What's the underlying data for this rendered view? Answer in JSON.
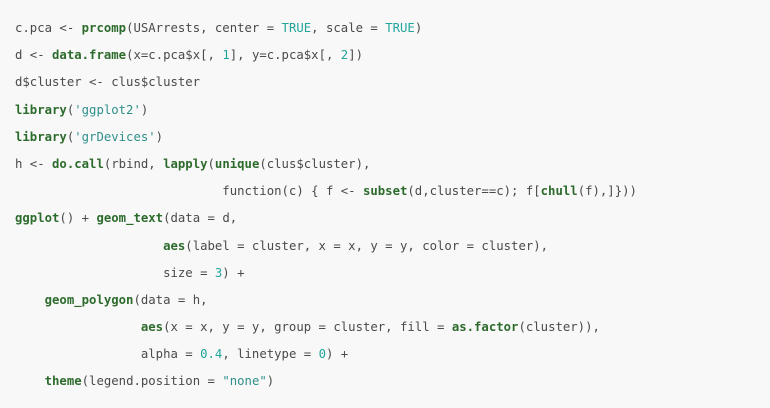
{
  "code": {
    "language": "R",
    "lines": [
      [
        {
          "t": "c.pca <- ",
          "c": "plain"
        },
        {
          "t": "prcomp",
          "c": "fn"
        },
        {
          "t": "(USArrests, center = ",
          "c": "plain"
        },
        {
          "t": "TRUE",
          "c": "kw"
        },
        {
          "t": ", scale = ",
          "c": "plain"
        },
        {
          "t": "TRUE",
          "c": "kw"
        },
        {
          "t": ")",
          "c": "plain"
        }
      ],
      [
        {
          "t": "d <- ",
          "c": "plain"
        },
        {
          "t": "data.frame",
          "c": "fn"
        },
        {
          "t": "(x=c.pca$x[, ",
          "c": "plain"
        },
        {
          "t": "1",
          "c": "num"
        },
        {
          "t": "], y=c.pca$x[, ",
          "c": "plain"
        },
        {
          "t": "2",
          "c": "num"
        },
        {
          "t": "])",
          "c": "plain"
        }
      ],
      [
        {
          "t": "d$cluster <- clus$cluster",
          "c": "plain"
        }
      ],
      [
        {
          "t": "library",
          "c": "fn"
        },
        {
          "t": "(",
          "c": "plain"
        },
        {
          "t": "'ggplot2'",
          "c": "str"
        },
        {
          "t": ")",
          "c": "plain"
        }
      ],
      [
        {
          "t": "library",
          "c": "fn"
        },
        {
          "t": "(",
          "c": "plain"
        },
        {
          "t": "'grDevices'",
          "c": "str"
        },
        {
          "t": ")",
          "c": "plain"
        }
      ],
      [
        {
          "t": "h <- ",
          "c": "plain"
        },
        {
          "t": "do.call",
          "c": "fn"
        },
        {
          "t": "(rbind, ",
          "c": "plain"
        },
        {
          "t": "lapply",
          "c": "fn"
        },
        {
          "t": "(",
          "c": "plain"
        },
        {
          "t": "unique",
          "c": "fn"
        },
        {
          "t": "(clus$cluster),",
          "c": "plain"
        }
      ],
      [
        {
          "t": "                            function(c) { f <- ",
          "c": "plain"
        },
        {
          "t": "subset",
          "c": "fn"
        },
        {
          "t": "(d,cluster==c); f[",
          "c": "plain"
        },
        {
          "t": "chull",
          "c": "fn"
        },
        {
          "t": "(f),]}))",
          "c": "plain"
        }
      ],
      [
        {
          "t": "ggplot",
          "c": "fn"
        },
        {
          "t": "() + ",
          "c": "plain"
        },
        {
          "t": "geom_text",
          "c": "fn"
        },
        {
          "t": "(data = d,",
          "c": "plain"
        }
      ],
      [
        {
          "t": "                    ",
          "c": "plain"
        },
        {
          "t": "aes",
          "c": "fn"
        },
        {
          "t": "(label = cluster, x = x, y = y, color = cluster),",
          "c": "plain"
        }
      ],
      [
        {
          "t": "                    size = ",
          "c": "plain"
        },
        {
          "t": "3",
          "c": "num"
        },
        {
          "t": ") +",
          "c": "plain"
        }
      ],
      [
        {
          "t": "    ",
          "c": "plain"
        },
        {
          "t": "geom_polygon",
          "c": "fn"
        },
        {
          "t": "(data = h,",
          "c": "plain"
        }
      ],
      [
        {
          "t": "                 ",
          "c": "plain"
        },
        {
          "t": "aes",
          "c": "fn"
        },
        {
          "t": "(x = x, y = y, group = cluster, fill = ",
          "c": "plain"
        },
        {
          "t": "as.factor",
          "c": "fn"
        },
        {
          "t": "(cluster)),",
          "c": "plain"
        }
      ],
      [
        {
          "t": "                 alpha = ",
          "c": "plain"
        },
        {
          "t": "0.4",
          "c": "num"
        },
        {
          "t": ", linetype = ",
          "c": "plain"
        },
        {
          "t": "0",
          "c": "num"
        },
        {
          "t": ") +",
          "c": "plain"
        }
      ],
      [
        {
          "t": "    ",
          "c": "plain"
        },
        {
          "t": "theme",
          "c": "fn"
        },
        {
          "t": "(legend.position = ",
          "c": "plain"
        },
        {
          "t": "\"none\"",
          "c": "str"
        },
        {
          "t": ")",
          "c": "plain"
        }
      ]
    ]
  },
  "colors": {
    "background": "#f8f8f8",
    "plain": "#4a4a4a",
    "function": "#2d6b2d",
    "number": "#22a49b",
    "string": "#2f8f8a"
  }
}
